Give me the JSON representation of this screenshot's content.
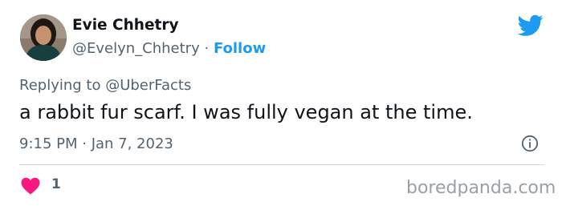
{
  "author": {
    "name": "Evie Chhetry",
    "handle": "@Evelyn_Chhetry",
    "separator": "·",
    "follow_label": "Follow"
  },
  "tweet": {
    "reply_prefix": "Replying to ",
    "reply_handle": "@UberFacts",
    "text": "a rabbit fur scarf. I was fully vegan at the time.",
    "timestamp": "9:15 PM · Jan 7, 2023",
    "like_count": "1"
  },
  "watermark": "boredpanda.com",
  "colors": {
    "accent": "#1d9bf0",
    "heart": "#f91880",
    "secondary_text": "#536471",
    "primary_text": "#0f1419"
  },
  "icons": {
    "brand": "twitter-bird-icon",
    "info": "info-icon",
    "like": "heart-icon"
  }
}
